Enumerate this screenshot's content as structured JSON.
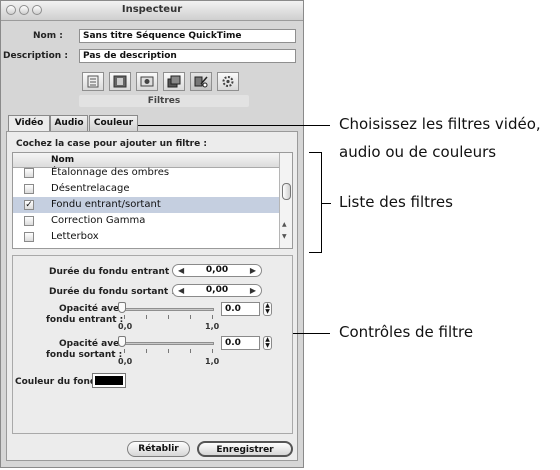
{
  "window": {
    "title": "Inspecteur"
  },
  "fields": {
    "name_label": "Nom :",
    "name_value": "Sans titre  Séquence QuickTime",
    "description_label": "Description :",
    "description_value": "Pas de description"
  },
  "toolbar": {
    "buttons": [
      "info",
      "film-strip",
      "media",
      "layers",
      "filters",
      "settings"
    ],
    "section_label": "Filtres"
  },
  "tabs": [
    {
      "label": "Vidéo",
      "selected": true
    },
    {
      "label": "Audio",
      "selected": false
    },
    {
      "label": "Couleur",
      "selected": false
    }
  ],
  "filter_list": {
    "instruction": "Cochez la case pour ajouter un filtre :",
    "column_header": "Nom",
    "items": [
      {
        "name": "Étalonnage des ombres",
        "checked": false
      },
      {
        "name": "Désentrelacage",
        "checked": false
      },
      {
        "name": "Fondu entrant/sortant",
        "checked": true,
        "selected": true
      },
      {
        "name": "Correction Gamma",
        "checked": false
      },
      {
        "name": "Letterbox",
        "checked": false
      }
    ]
  },
  "settings": {
    "fade_in_label": "Durée du fondu entrant :",
    "fade_in_value": "0,00",
    "fade_out_label": "Durée du fondu sortant :",
    "fade_out_value": "0,00",
    "opacity_in_label_1": "Opacité avec",
    "opacity_in_label_2": "fondu entrant :",
    "opacity_in_value": "0.0",
    "opacity_out_label_1": "Opacité avec",
    "opacity_out_label_2": "fondu sortant :",
    "opacity_out_value": "0.0",
    "slider_min_label": "0,0",
    "slider_max_label": "1,0",
    "fade_color_label": "Couleur du fondu :",
    "fade_color": "#000000"
  },
  "buttons": {
    "revert": "Rétablir",
    "save": "Enregistrer"
  },
  "callouts": {
    "tabs": "Choisissez les filtres vidéo,",
    "tabs_line2": "audio ou de couleurs",
    "list": "Liste des filtres",
    "controls": "Contrôles de filtre"
  }
}
